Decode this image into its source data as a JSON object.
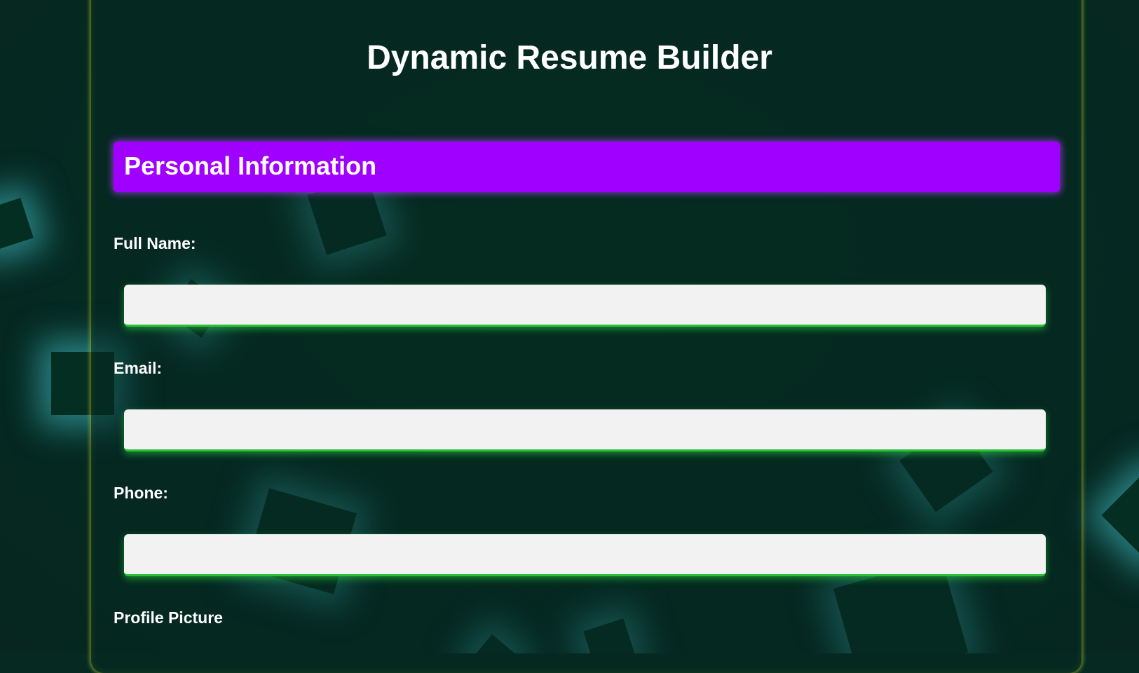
{
  "page": {
    "title": "Dynamic Resume Builder"
  },
  "section": {
    "title": "Personal Information"
  },
  "fields": {
    "full_name": {
      "label": "Full Name:",
      "value": ""
    },
    "email": {
      "label": "Email:",
      "value": ""
    },
    "phone": {
      "label": "Phone:",
      "value": ""
    },
    "profile_picture": {
      "label": "Profile Picture"
    }
  },
  "colors": {
    "background": "#062a22",
    "section_bar": "#a000ff",
    "input_glow": "#2fbf3a",
    "container_border": "#aabe28",
    "shard_glow": "#46c8d2"
  }
}
